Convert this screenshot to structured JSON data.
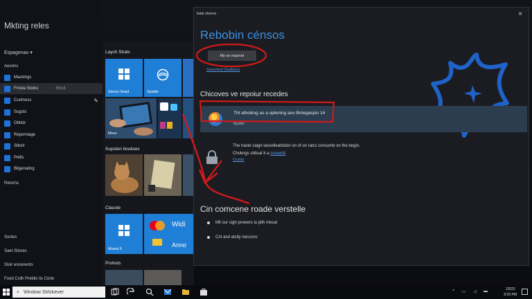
{
  "left": {
    "title": "Mkting reles",
    "section_label": "Espagenao ▾",
    "sub_label": "Aeorins",
    "items": [
      {
        "label": "Mackings",
        "extra": ""
      },
      {
        "label": "Frnola Stolos",
        "extra": "Mncil."
      },
      {
        "label": "Cuntness",
        "extra": ""
      },
      {
        "label": "Sugsts",
        "extra": ""
      },
      {
        "label": "Obtick",
        "extra": ""
      },
      {
        "label": "Reporniage",
        "extra": ""
      },
      {
        "label": "Stbolr",
        "extra": ""
      },
      {
        "label": "Pellts",
        "extra": ""
      },
      {
        "label": "Bligenating",
        "extra": ""
      }
    ],
    "returns": "Retorns",
    "bottom": [
      "Sonlos",
      "Saet Stiores",
      "Stoir encenents",
      "Food Crdh Preblis tis Corle"
    ]
  },
  "tiles": {
    "groups": [
      "Laych Strals",
      "Supsten fesdows",
      "Clauste",
      "Prohuts"
    ],
    "t_store": "Steres Sead",
    "t_spst": "Spstite",
    "t_mrou": "Mrou",
    "t_moant": "Moant 5",
    "t_anno": "Anno",
    "t_widi": "Widi"
  },
  "dialog": {
    "title": "fatal elanne",
    "close": "×",
    "heading": "Rebobin cénsos",
    "button": "My oe riaamet",
    "link1": "Sreevlerd Cladbans",
    "section_heading": "Chicoves ve repoiur recedes",
    "status_text": "Tht athoikng as a oplening ano Bntegaspin 14",
    "status_sub": "Bjurtel",
    "lock_text": "The haste caign laoselleatistion on of on ralcs consumb on the begin.",
    "lock_text2_prefix": "Chukngs cliduat b a ",
    "lock_text2_link": "sreoartd",
    "lock_link": "Crunto",
    "heading2": "Cin comcene roade verstelle",
    "bullets": [
      "Mll our sigh prowers la pith mesal",
      "Cnt and atctly neccons"
    ]
  },
  "taskbar": {
    "search_value": "Window Strlckever",
    "time": "12022",
    "date": "5:03 PM"
  },
  "colors": {
    "accent": "#1e73d9",
    "annotation": "#d11a1a",
    "heading": "#3b8fe0",
    "star_outline": "#1f63c8"
  }
}
